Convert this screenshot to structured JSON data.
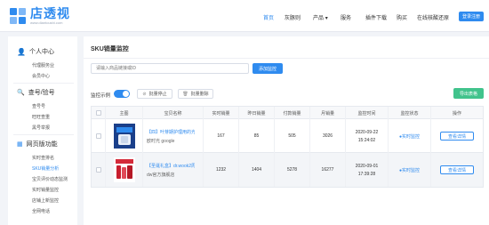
{
  "header": {
    "logo_title": "店透视",
    "logo_sub": "www.diantoushi.com",
    "nav": [
      "首页",
      "灰豚则",
      "产品",
      "服务",
      "插件下载",
      "购买",
      "在线核酸还原"
    ],
    "login_label": "登录注册"
  },
  "sidebar": {
    "groups": [
      {
        "label": "个人中心",
        "items": [
          "代理服务业",
          "会员中心"
        ]
      },
      {
        "label": "查号/验号",
        "items": [
          "查号号",
          "旺旺查重",
          "黑号举报"
        ]
      },
      {
        "label": "网页版功能",
        "items": [
          "实时查排名",
          "SKU销量分析",
          "宝贝评价动态监测",
          "实时销量监控",
          "店铺上新监控",
          "全网电话"
        ]
      }
    ]
  },
  "main": {
    "title": "SKU销量监控",
    "search_placeholder": "请输入商品链接或ID",
    "add_label": "添加监控",
    "monitor_label": "监控示例",
    "batch_stop": "批量停止",
    "batch_delete": "批量删除",
    "export_label": "导出表格"
  },
  "table": {
    "columns": [
      "",
      "主图",
      "宝贝名称",
      "实时销量",
      "昨日销量",
      "付款销量",
      "月销量",
      "监控时间",
      "监控状态",
      "操作"
    ],
    "rows": [
      {
        "name": "【四】叶芽期护理用的光索...",
        "shop": "欧时光 google",
        "realtime": "167",
        "yesterday": "85",
        "paid": "505",
        "monthly": "3026",
        "date": "2020-09-22",
        "time": "15:24:02",
        "status": "●实时监控",
        "action": "查看详情"
      },
      {
        "name": "【圣诞礼盒】dr.wook2周...",
        "shop": "dw官方旗舰店",
        "realtime": "1232",
        "yesterday": "1404",
        "paid": "5278",
        "monthly": "16277",
        "date": "2020-09-01",
        "time": "17:39:28",
        "status": "●实时监控",
        "action": "查看详情"
      }
    ]
  },
  "colors": {
    "accent": "#2f8bef",
    "export": "#41c38c"
  }
}
